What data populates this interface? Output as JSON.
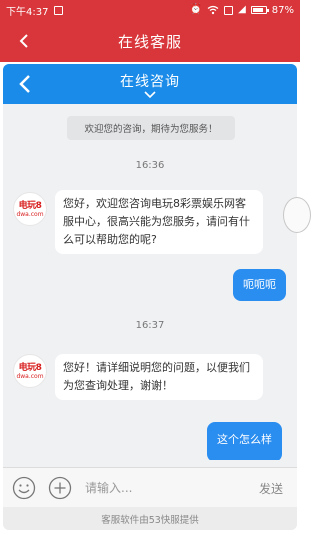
{
  "status_bar": {
    "time": "下午4:37",
    "battery": "87%",
    "battery_level": 0.87
  },
  "app_bar": {
    "title": "在线客服",
    "back_icon": "chevron-left-icon"
  },
  "chat_header": {
    "title": "在线咨询",
    "back_icon": "chevron-left-icon",
    "collapse_icon": "chevron-down-icon"
  },
  "messages": {
    "notice": "欢迎您的咨询，期待为您服务！",
    "time_1": "16:36",
    "agent_msg_1": "您好，欢迎您咨询电玩8彩票娱乐网客服中心，很高兴能为您服务，请问有什么可以帮助您的呢?",
    "user_msg_1": "呃呃呃",
    "time_2": "16:37",
    "agent_msg_2": "您好！请详细说明您的问题，以便我们为您查询处理，谢谢！",
    "user_msg_2": "这个怎么样",
    "agent_avatar_line1": "电玩8",
    "agent_avatar_line2": "dwa.com"
  },
  "input_bar": {
    "placeholder": "请输入...",
    "send_label": "发送",
    "emoji_icon": "smiley-icon",
    "plus_icon": "plus-circle-icon"
  },
  "footer": {
    "text": "客服软件由53快服提供"
  },
  "colors": {
    "brand_red": "#d8363a",
    "chat_blue": "#1a8be8",
    "user_bubble": "#2a8df0"
  }
}
